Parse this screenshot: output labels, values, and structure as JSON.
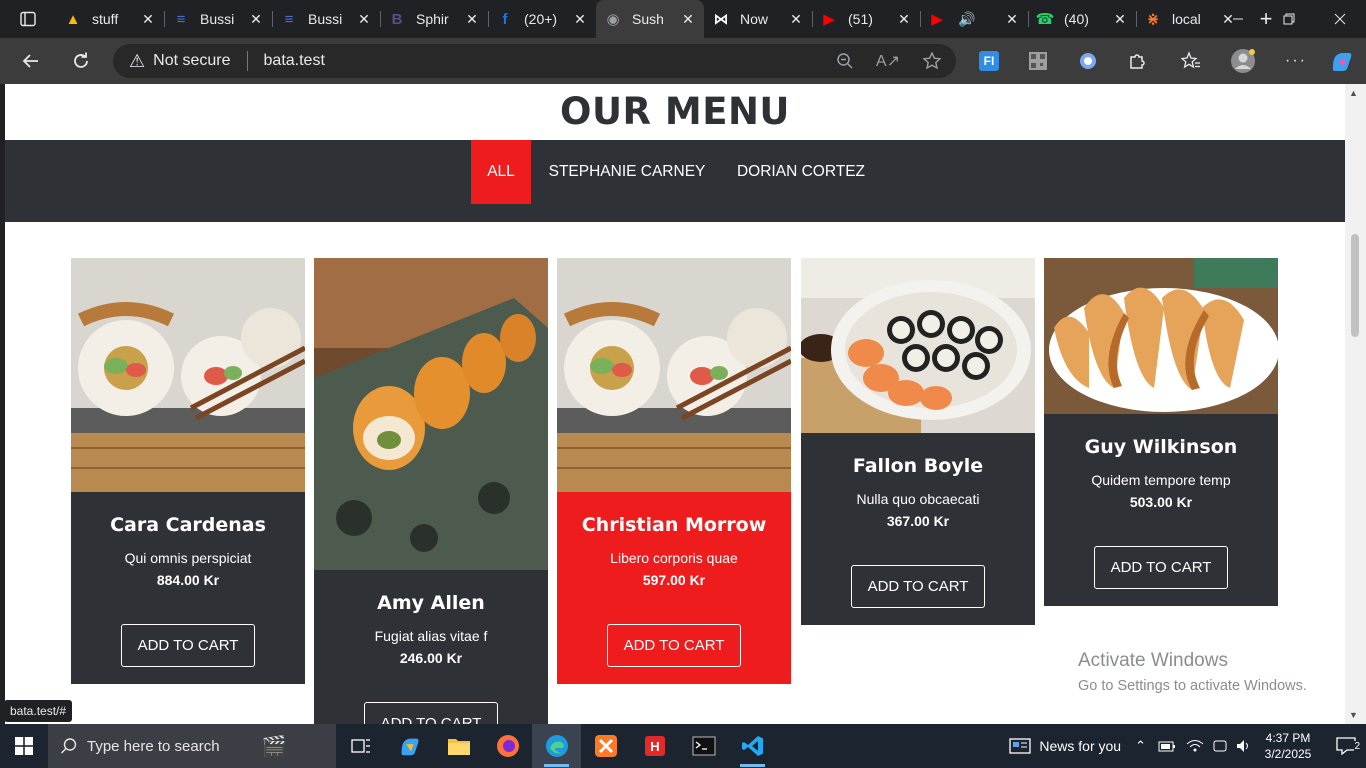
{
  "browser": {
    "tabs": [
      {
        "label": "stuff",
        "icon": "google-drive-icon",
        "color": "#fbbc04"
      },
      {
        "label": "Bussi",
        "icon": "docs-icon",
        "color": "#4a6fd0"
      },
      {
        "label": "Bussi",
        "icon": "docs-icon",
        "color": "#4a6fd0"
      },
      {
        "label": "Sphir",
        "icon": "bootstrap-icon",
        "color": "#5a4b8a"
      },
      {
        "label": "(20+)",
        "icon": "facebook-icon",
        "color": "#1877f2"
      },
      {
        "label": "Sush",
        "icon": "globe-icon",
        "color": "#9aa0a6"
      },
      {
        "label": "Now",
        "icon": "bowtie-icon",
        "color": "#ffffff"
      },
      {
        "label": "(51)",
        "icon": "youtube-icon",
        "color": "#ff0000"
      },
      {
        "label": "",
        "icon": "youtube-icon",
        "color": "#ff0000"
      },
      {
        "label": "(40)",
        "icon": "whatsapp-icon",
        "color": "#25d366"
      },
      {
        "label": "local",
        "icon": "xampp-icon",
        "color": "#fb7a24"
      }
    ],
    "address": {
      "security_label": "Not secure",
      "url": "bata.test"
    },
    "status_url": "bata.test/#"
  },
  "page": {
    "title": "OUR MENU",
    "filters": [
      "ALL",
      "STEPHANIE CARNEY",
      "DORIAN CORTEZ"
    ],
    "active_filter": "ALL",
    "cart_label": "ADD TO CART",
    "items": [
      {
        "name": "Cara Cardenas",
        "description": "Qui omnis perspiciat",
        "price": "884.00 Kr"
      },
      {
        "name": "Amy Allen",
        "description": "Fugiat alias vitae f",
        "price": "246.00 Kr"
      },
      {
        "name": "Christian Morrow",
        "description": "Libero corporis quae",
        "price": "597.00 Kr"
      },
      {
        "name": "Fallon Boyle",
        "description": "Nulla quo obcaecati",
        "price": "367.00 Kr"
      },
      {
        "name": "Guy Wilkinson",
        "description": "Quidem tempore temp",
        "price": "503.00 Kr"
      }
    ],
    "colors": {
      "accent": "#ee1c1c",
      "dark": "#2e3236"
    }
  },
  "watermark": {
    "line1": "Activate Windows",
    "line2": "Go to Settings to activate Windows."
  },
  "taskbar": {
    "search_placeholder": "Type here to search",
    "news_label": "News for you",
    "time": "4:37 PM",
    "date": "3/2/2025",
    "notification_count": "2"
  }
}
